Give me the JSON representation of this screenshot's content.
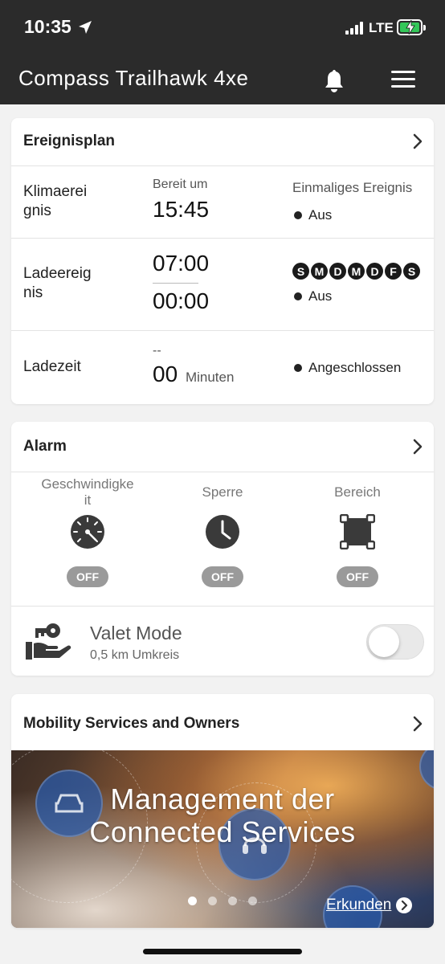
{
  "status_bar": {
    "time": "10:35",
    "network": "LTE"
  },
  "header": {
    "title": "Compass Trailhawk 4xe",
    "bell_icon": "bell-icon",
    "menu_icon": "hamburger-menu-icon"
  },
  "schedule": {
    "title": "Ereignisplan",
    "climate": {
      "label": "Klimaereignis",
      "label_lines": [
        "Klimaerei",
        "gnis"
      ],
      "ready_label": "Bereit um",
      "time": "15:45",
      "type": "Einmaliges Ereignis",
      "status": "Aus"
    },
    "charge": {
      "label": "Ladeereignis",
      "label_lines": [
        "Ladeereig",
        "nis"
      ],
      "start_time": "07:00",
      "end_time": "00:00",
      "days": [
        "S",
        "M",
        "D",
        "M",
        "D",
        "F",
        "S"
      ],
      "status": "Aus"
    },
    "charge_time": {
      "label": "Ladezeit",
      "placeholder": "--",
      "value": "00",
      "unit": "Minuten",
      "status": "Angeschlossen"
    }
  },
  "alarm": {
    "title": "Alarm",
    "items": [
      {
        "label": "Geschwindigkeit",
        "label_lines": [
          "Geschwindigke",
          "it"
        ],
        "icon": "speedometer-icon",
        "state": "OFF"
      },
      {
        "label": "Sperre",
        "label_lines": [
          "Sperre"
        ],
        "icon": "clock-icon",
        "state": "OFF"
      },
      {
        "label": "Bereich",
        "label_lines": [
          "Bereich"
        ],
        "icon": "area-icon",
        "state": "OFF"
      }
    ],
    "valet": {
      "title": "Valet Mode",
      "subtitle": "0,5 km Umkreis",
      "icon": "valet-key-hand-icon",
      "enabled": false
    }
  },
  "mobility": {
    "title": "Mobility Services and Owners",
    "banner_title_lines": [
      "Management der",
      "Connected Services"
    ],
    "explore_label": "Erkunden",
    "pages": 4,
    "active_page": 1
  }
}
